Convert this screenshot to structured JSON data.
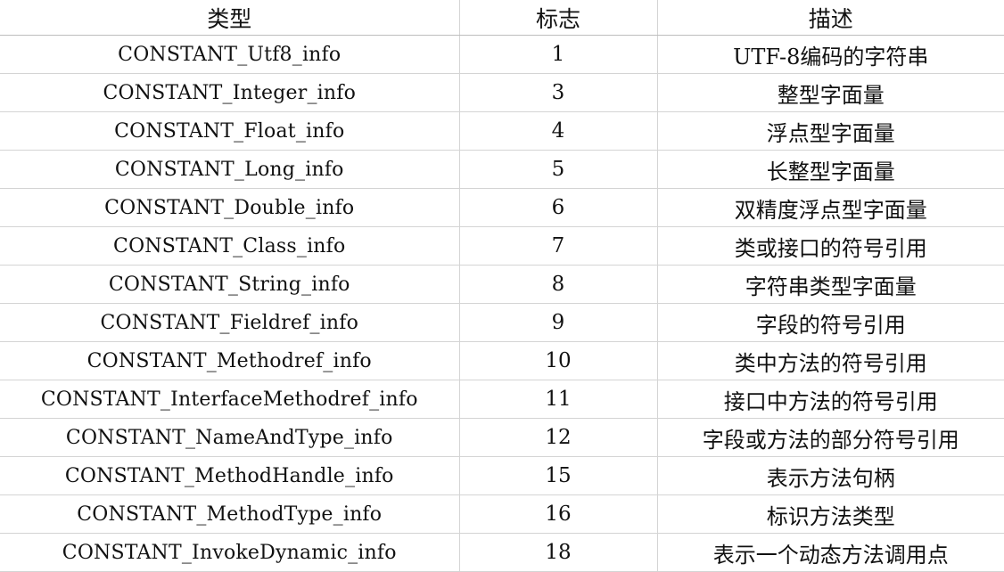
{
  "table": {
    "headers": [
      "类型",
      "标志",
      "描述"
    ],
    "rows": [
      {
        "type": "CONSTANT_Utf8_info",
        "tag": "1",
        "desc": "UTF-8编码的字符串"
      },
      {
        "type": "CONSTANT_Integer_info",
        "tag": "3",
        "desc": "整型字面量"
      },
      {
        "type": "CONSTANT_Float_info",
        "tag": "4",
        "desc": "浮点型字面量"
      },
      {
        "type": "CONSTANT_Long_info",
        "tag": "5",
        "desc": "长整型字面量"
      },
      {
        "type": "CONSTANT_Double_info",
        "tag": "6",
        "desc": "双精度浮点型字面量"
      },
      {
        "type": "CONSTANT_Class_info",
        "tag": "7",
        "desc": "类或接口的符号引用"
      },
      {
        "type": "CONSTANT_String_info",
        "tag": "8",
        "desc": "字符串类型字面量"
      },
      {
        "type": "CONSTANT_Fieldref_info",
        "tag": "9",
        "desc": "字段的符号引用"
      },
      {
        "type": "CONSTANT_Methodref_info",
        "tag": "10",
        "desc": "类中方法的符号引用"
      },
      {
        "type": "CONSTANT_InterfaceMethodref_info",
        "tag": "11",
        "desc": "接口中方法的符号引用"
      },
      {
        "type": "CONSTANT_NameAndType_info",
        "tag": "12",
        "desc": "字段或方法的部分符号引用"
      },
      {
        "type": "CONSTANT_MethodHandle_info",
        "tag": "15",
        "desc": "表示方法句柄"
      },
      {
        "type": "CONSTANT_MethodType_info",
        "tag": "16",
        "desc": "标识方法类型"
      },
      {
        "type": "CONSTANT_InvokeDynamic_info",
        "tag": "18",
        "desc": "表示一个动态方法调用点"
      }
    ]
  }
}
